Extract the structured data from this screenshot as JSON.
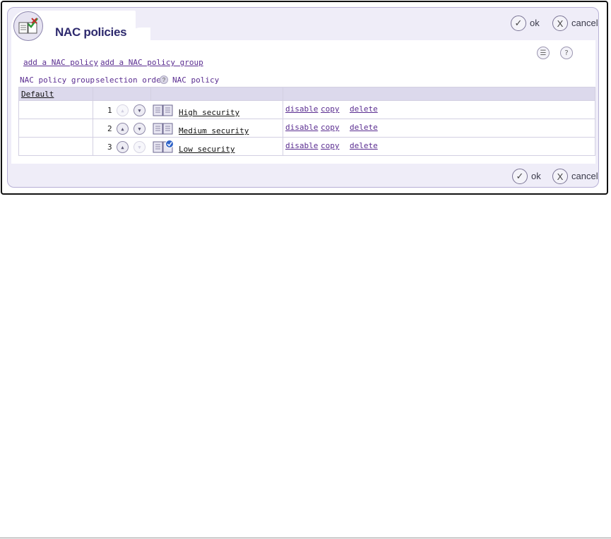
{
  "window": {
    "title": "NAC policies"
  },
  "buttons": {
    "ok_label": "ok",
    "cancel_label": "cancel",
    "ok_glyph": "✓",
    "cancel_glyph": "X"
  },
  "links": {
    "add_policy": "add a NAC policy",
    "add_group": "add a NAC policy group"
  },
  "toolbar_icons": {
    "list_glyph": "☰",
    "help_glyph": "?"
  },
  "columns": {
    "group": "NAC policy group",
    "order": "selection order",
    "policy": "NAC policy",
    "order_help_glyph": "?"
  },
  "groups": [
    {
      "name": "Default"
    }
  ],
  "rows": [
    {
      "order": "1",
      "name": "High security",
      "up_enabled": false,
      "down_enabled": true,
      "icon": "book-icon",
      "actions": [
        "disable",
        "copy",
        "delete"
      ]
    },
    {
      "order": "2",
      "name": "Medium security",
      "up_enabled": true,
      "down_enabled": true,
      "icon": "book-icon",
      "actions": [
        "disable",
        "copy",
        "delete"
      ]
    },
    {
      "order": "3",
      "name": "Low security",
      "up_enabled": true,
      "down_enabled": false,
      "icon": "book-check-icon",
      "actions": [
        "disable",
        "copy",
        "delete"
      ]
    }
  ],
  "arrows": {
    "up": "▲",
    "down": "▼"
  },
  "colors": {
    "link": "#5b2e91",
    "panel": "#efedf8",
    "header": "#dcd9ec",
    "title": "#2e2a6e"
  }
}
